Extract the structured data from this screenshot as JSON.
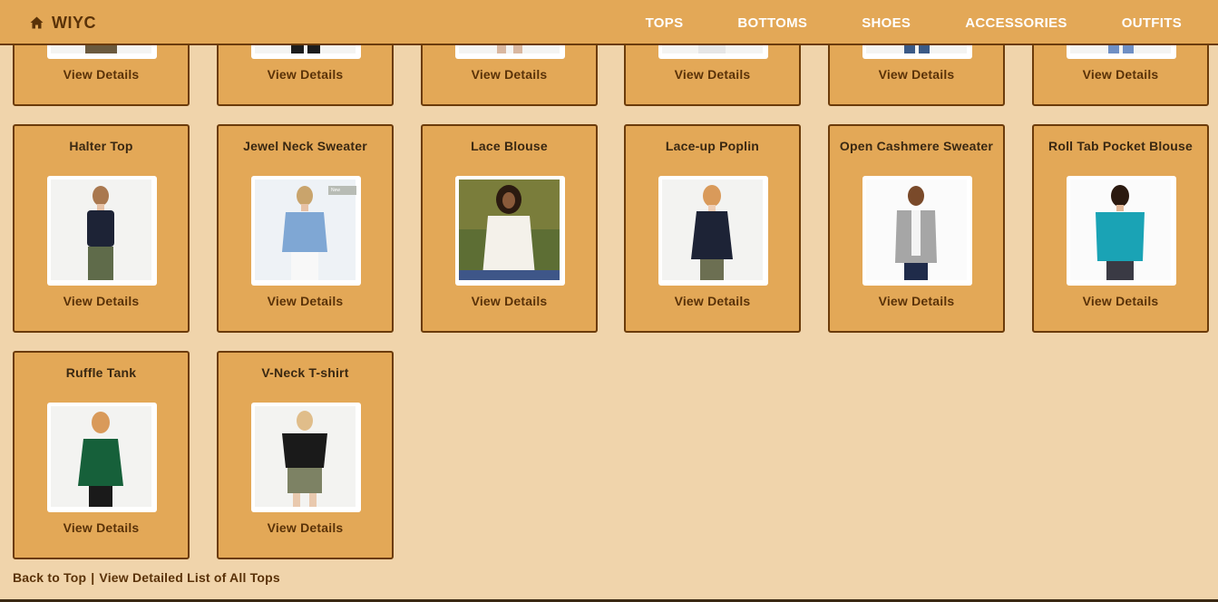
{
  "nav": {
    "brand": "WIYC",
    "brand_icon": "home-icon",
    "links": [
      "TOPS",
      "BOTTOMS",
      "SHOES",
      "ACCESSORIES",
      "OUTFITS"
    ]
  },
  "view_details_label": "View Details",
  "products": [
    {
      "title": "",
      "badge": ""
    },
    {
      "title": "",
      "badge": ""
    },
    {
      "title": "",
      "badge": ""
    },
    {
      "title": "",
      "badge": ""
    },
    {
      "title": "",
      "badge": ""
    },
    {
      "title": "",
      "badge": ""
    },
    {
      "title": "Halter Top",
      "badge": ""
    },
    {
      "title": "Jewel Neck Sweater",
      "badge": "New"
    },
    {
      "title": "Lace Blouse",
      "badge": ""
    },
    {
      "title": "Lace-up Poplin",
      "badge": ""
    },
    {
      "title": "Open Cashmere Sweater",
      "badge": ""
    },
    {
      "title": "Roll Tab Pocket Blouse",
      "badge": ""
    },
    {
      "title": "Ruffle Tank",
      "badge": ""
    },
    {
      "title": "V-Neck T-shirt",
      "badge": ""
    }
  ],
  "footer": {
    "back_to_top": "Back to Top",
    "separator": "|",
    "detailed_list": "View Detailed List of All Tops"
  },
  "colors": {
    "page_background": "#f0d4ab",
    "nav_background": "#e3a857",
    "card_background": "#e3a857",
    "card_border": "#6b3b0a",
    "text_dark": "#3a2812",
    "link_text": "#5a3208"
  }
}
